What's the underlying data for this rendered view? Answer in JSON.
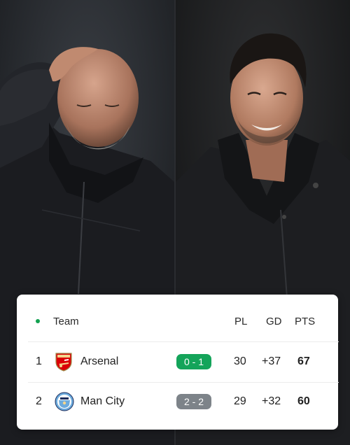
{
  "table": {
    "header": {
      "team": "Team",
      "pl": "PL",
      "gd": "GD",
      "pts": "PTS"
    },
    "rows": [
      {
        "position": "1",
        "team": "Arsenal",
        "crest": "arsenal-crest-icon",
        "last_result": "0 - 1",
        "result_type": "win",
        "pl": "30",
        "gd": "+37",
        "pts": "67"
      },
      {
        "position": "2",
        "team": "Man City",
        "crest": "man-city-crest-icon",
        "last_result": "2 - 2",
        "result_type": "draw",
        "pl": "29",
        "gd": "+32",
        "pts": "60"
      }
    ]
  },
  "colors": {
    "win": "#14a45a",
    "draw": "#7d8389",
    "live_dot": "#12a150",
    "arsenal_red": "#db0007",
    "city_blue": "#6cabdd"
  }
}
